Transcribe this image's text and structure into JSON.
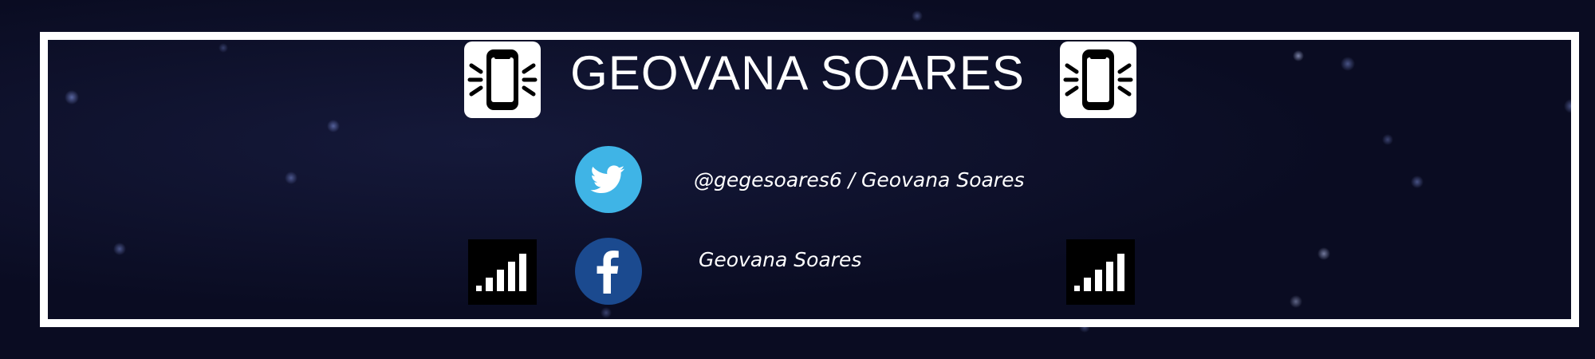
{
  "header": {
    "title": "GEOVANA SOARES"
  },
  "icons": {
    "left_phone": "vibrating-phone",
    "right_phone": "vibrating-phone",
    "left_signal": "signal-bars",
    "right_signal": "signal-bars"
  },
  "social": {
    "twitter": {
      "icon": "twitter-bird",
      "color": "#3fb4e6",
      "handle": "@gegesoares6 / Geovana Soares"
    },
    "facebook": {
      "icon": "facebook-f",
      "color": "#1b4a8f",
      "handle": "Geovana Soares"
    }
  },
  "colors": {
    "background": "#0a0c22",
    "frame": "#ffffff",
    "text": "#ffffff"
  }
}
